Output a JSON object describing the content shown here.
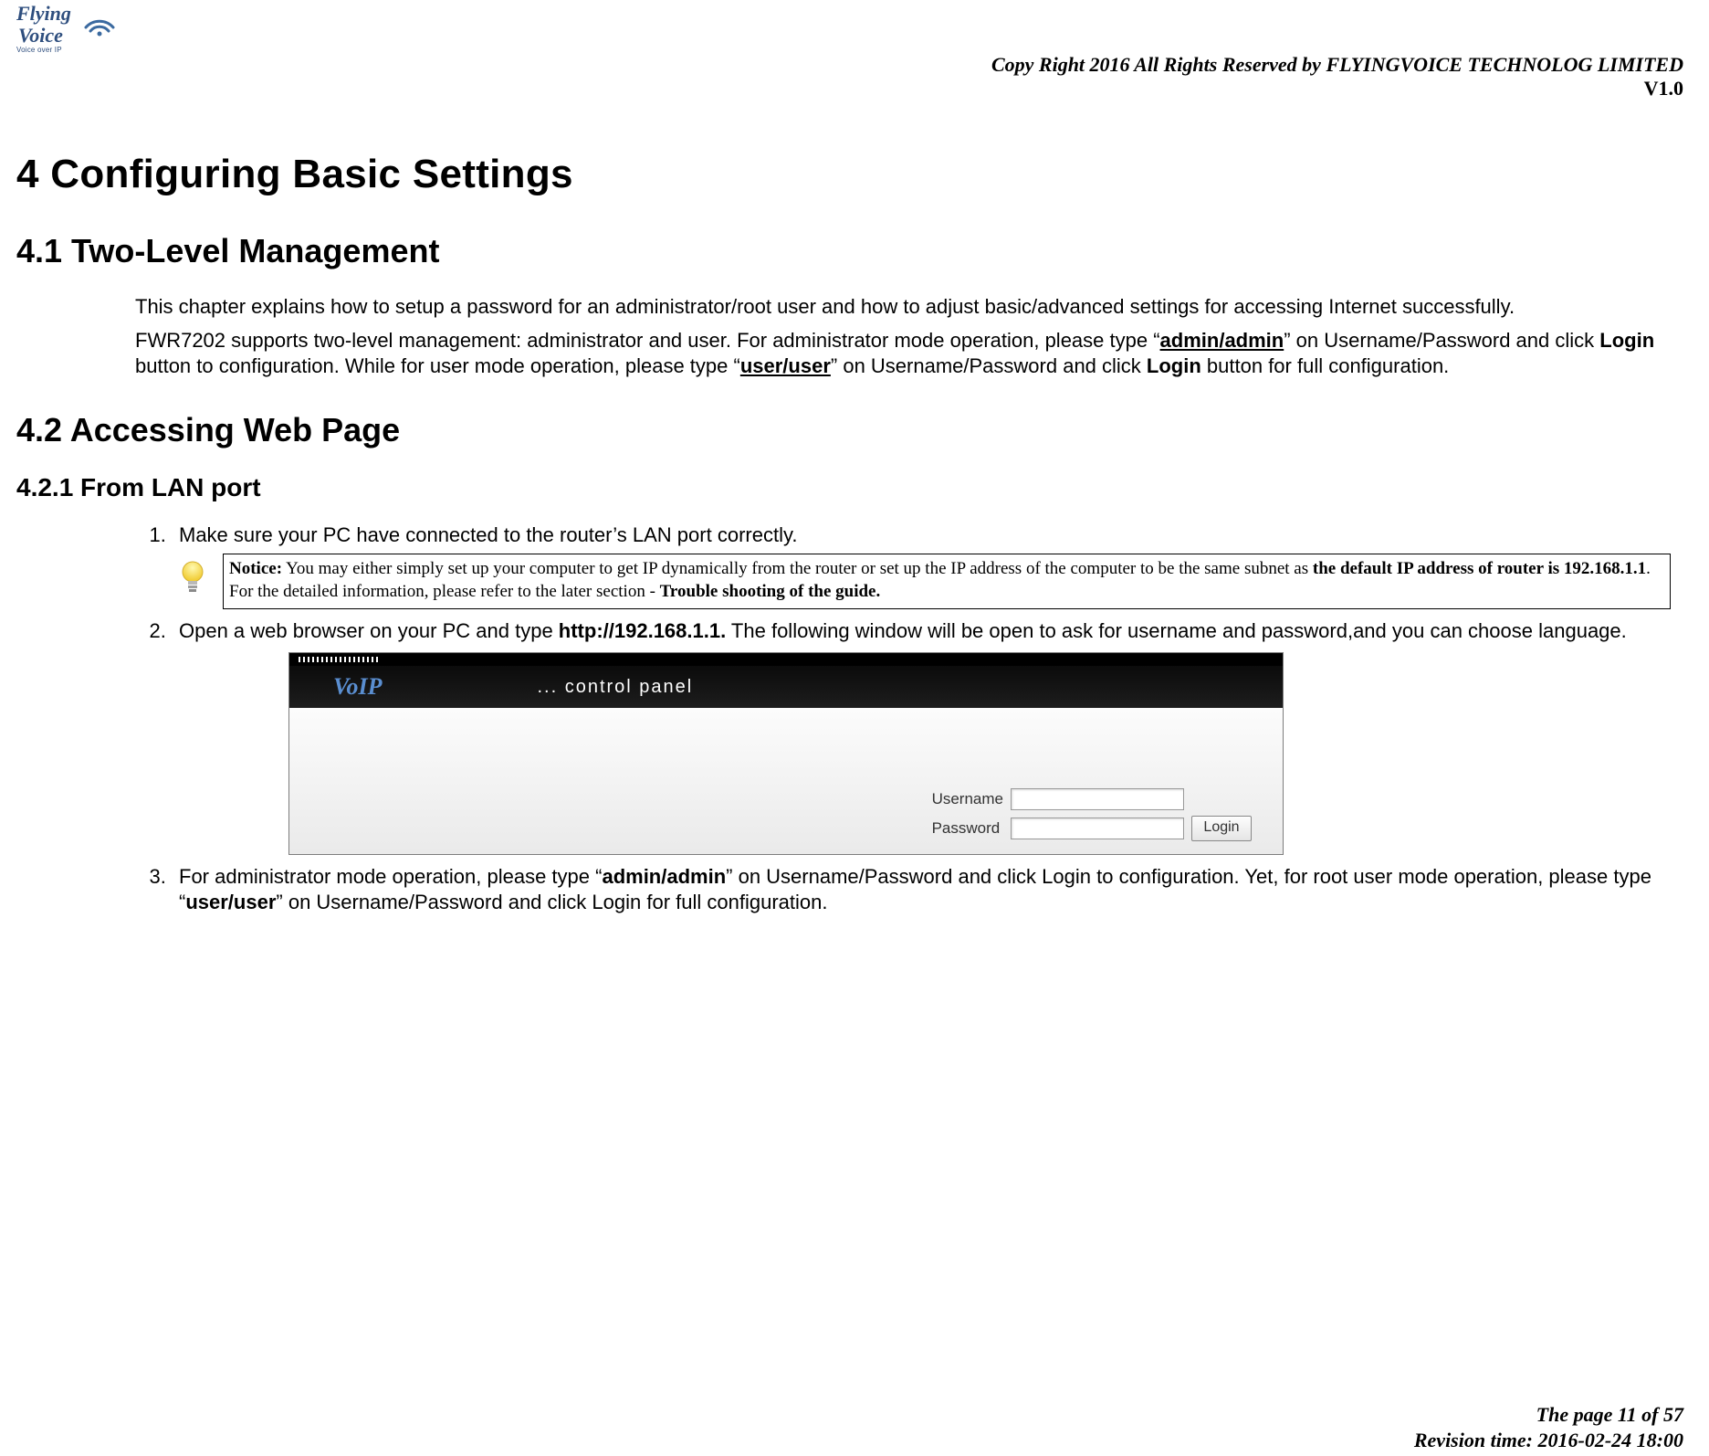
{
  "logo": {
    "line1": "Flying",
    "line2": "Voice",
    "tagline": "Voice over IP"
  },
  "header": {
    "copyright": "Copy Right 2016 All Rights Reserved by FLYINGVOICE TECHNOLOG LIMITED",
    "version": "V1.0"
  },
  "h1": "4   Configuring Basic Settings",
  "s41": {
    "title": "4.1 Two-Level Management",
    "p1": "This chapter explains how to setup a password for an administrator/root user and how to adjust basic/advanced settings for accessing Internet successfully.",
    "p2_a": "FWR7202 supports two-level management: administrator and user. For administrator mode operation, please type “",
    "p2_bu1": "admin/admin",
    "p2_b": "” on Username/Password and click ",
    "p2_bold1": "Login",
    "p2_c": " button to configuration. While for user mode operation, please type “",
    "p2_bu2": "user/user",
    "p2_d": "” on Username/Password and click ",
    "p2_bold2": "Login",
    "p2_e": " button for full configuration."
  },
  "s42": {
    "title": "4.2 Accessing Web Page",
    "sub": "4.2.1 From LAN port",
    "step1": "Make sure your PC have connected to the router’s LAN port correctly.",
    "notice": {
      "lead": "Notice:",
      "a": " You may either simply set up your computer to get IP dynamically from the router or set up the IP address of the computer to be the same subnet as ",
      "b1": "the default IP address of router is 192.168.1.1",
      "b": ". For the detailed information, please refer to the later section - ",
      "b2": "Trouble shooting of the guide."
    },
    "step2_a": "Open a web browser on your PC and type ",
    "step2_url": "http://192.168.1.1.",
    "step2_b": " The following window will be open to ask for username and password,and you can choose language.",
    "login": {
      "voip": "VoIP",
      "cp": "... control panel",
      "username_label": "Username",
      "password_label": "Password",
      "login_btn": "Login"
    },
    "step3_a": "For administrator mode operation, please type “",
    "step3_b1": "admin/admin",
    "step3_b": "” on Username/Password and click Login to configuration. Yet, for root user mode operation, please type “",
    "step3_b2": "user/user",
    "step3_c": "” on Username/Password and click Login for full configuration."
  },
  "footer": {
    "page": "The page 11 of 57",
    "rev": "Revision time: 2016-02-24 18:00"
  }
}
